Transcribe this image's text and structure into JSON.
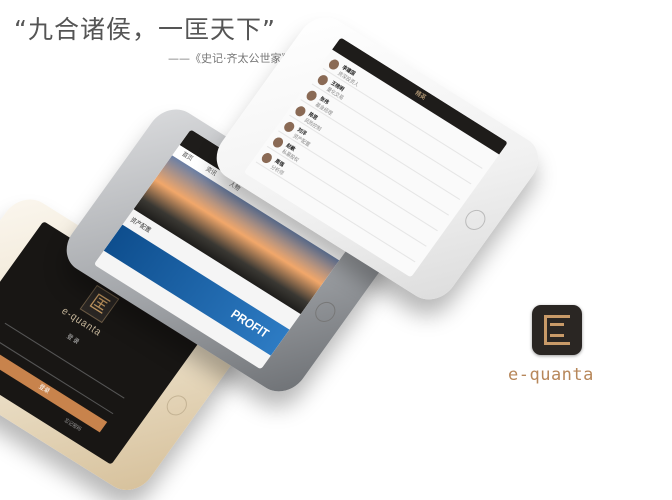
{
  "quote": {
    "text": "“九合诸侯，一匡天下”",
    "source": "——《史记·齐太公世家》"
  },
  "phone_login": {
    "brand": "e-quanta",
    "title": "登 录",
    "login_button": "登录",
    "forgot": "忘记密码"
  },
  "phone_news": {
    "tabs": [
      "首页",
      "资讯",
      "人物"
    ],
    "caption": "资产配置",
    "banner": "PROFIT"
  },
  "phone_list": {
    "title": "精英",
    "rows": [
      {
        "name": "李建国",
        "text": "资深投资人"
      },
      {
        "name": "王晓明",
        "text": "量化交易"
      },
      {
        "name": "张伟",
        "text": "基金经理"
      },
      {
        "name": "陈思",
        "text": "风险控制"
      },
      {
        "name": "刘洋",
        "text": "资产配置"
      },
      {
        "name": "赵敏",
        "text": "私募股权"
      },
      {
        "name": "周强",
        "text": "分析师"
      }
    ]
  },
  "logo": {
    "name": "e-quanta",
    "accent": "#c89a68"
  }
}
